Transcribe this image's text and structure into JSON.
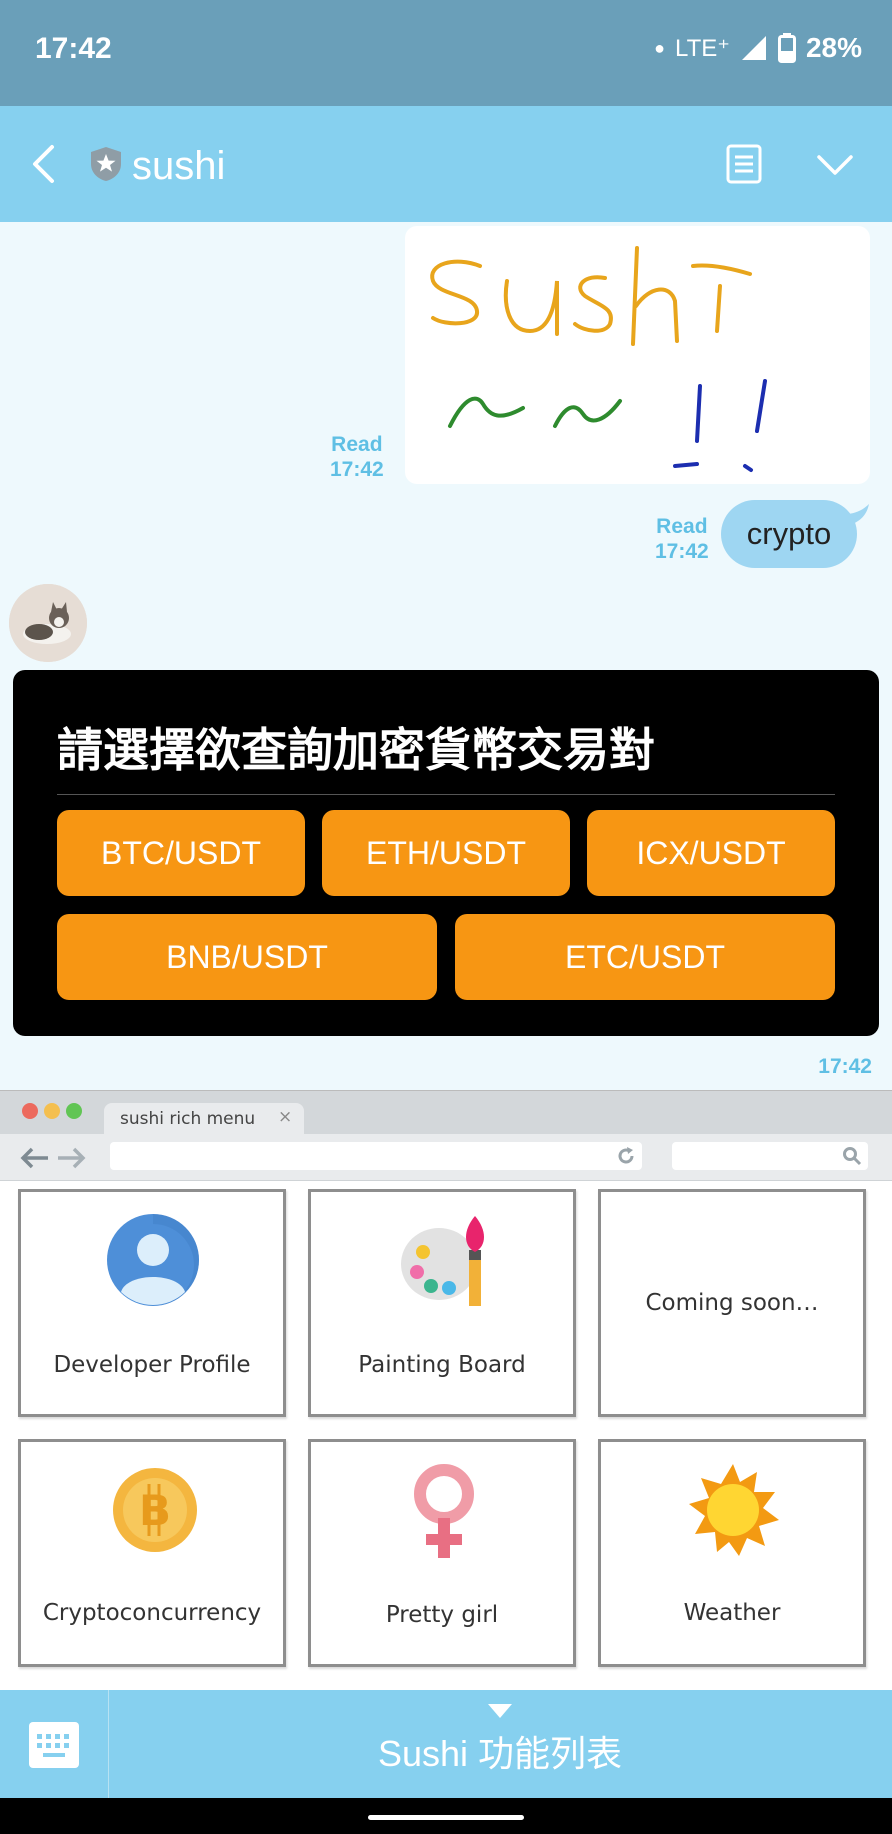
{
  "status_bar": {
    "time": "17:42",
    "network": "LTE⁺",
    "battery": "28%"
  },
  "header": {
    "title": "sushi"
  },
  "chat": {
    "msg1_read": "Read",
    "msg1_time": "17:42",
    "msg2_read": "Read",
    "msg2_time": "17:42",
    "msg2_text": "crypto",
    "card": {
      "title": "請選擇欲查詢加密貨幣交易對",
      "buttons": [
        "BTC/USDT",
        "ETH/USDT",
        "ICX/USDT",
        "BNB/USDT",
        "ETC/USDT"
      ],
      "time": "17:42"
    }
  },
  "rich_menu": {
    "tab_title": "sushi rich menu",
    "tab_close": "×",
    "tiles": [
      {
        "label": "Developer Profile",
        "icon": "user-icon"
      },
      {
        "label": "Painting Board",
        "icon": "palette-icon"
      },
      {
        "label": "Coming soon…",
        "icon": ""
      },
      {
        "label": "Cryptoconcurrency",
        "icon": "bitcoin-icon"
      },
      {
        "label": "Pretty girl",
        "icon": "female-symbol-icon"
      },
      {
        "label": "Weather",
        "icon": "sun-icon"
      }
    ]
  },
  "bottom_bar": {
    "menu_label": "Sushi 功能列表"
  },
  "colors": {
    "header": "#86D0EF",
    "status": "#6A9FB9",
    "button": "#F79613",
    "read": "#5FBFE4"
  }
}
